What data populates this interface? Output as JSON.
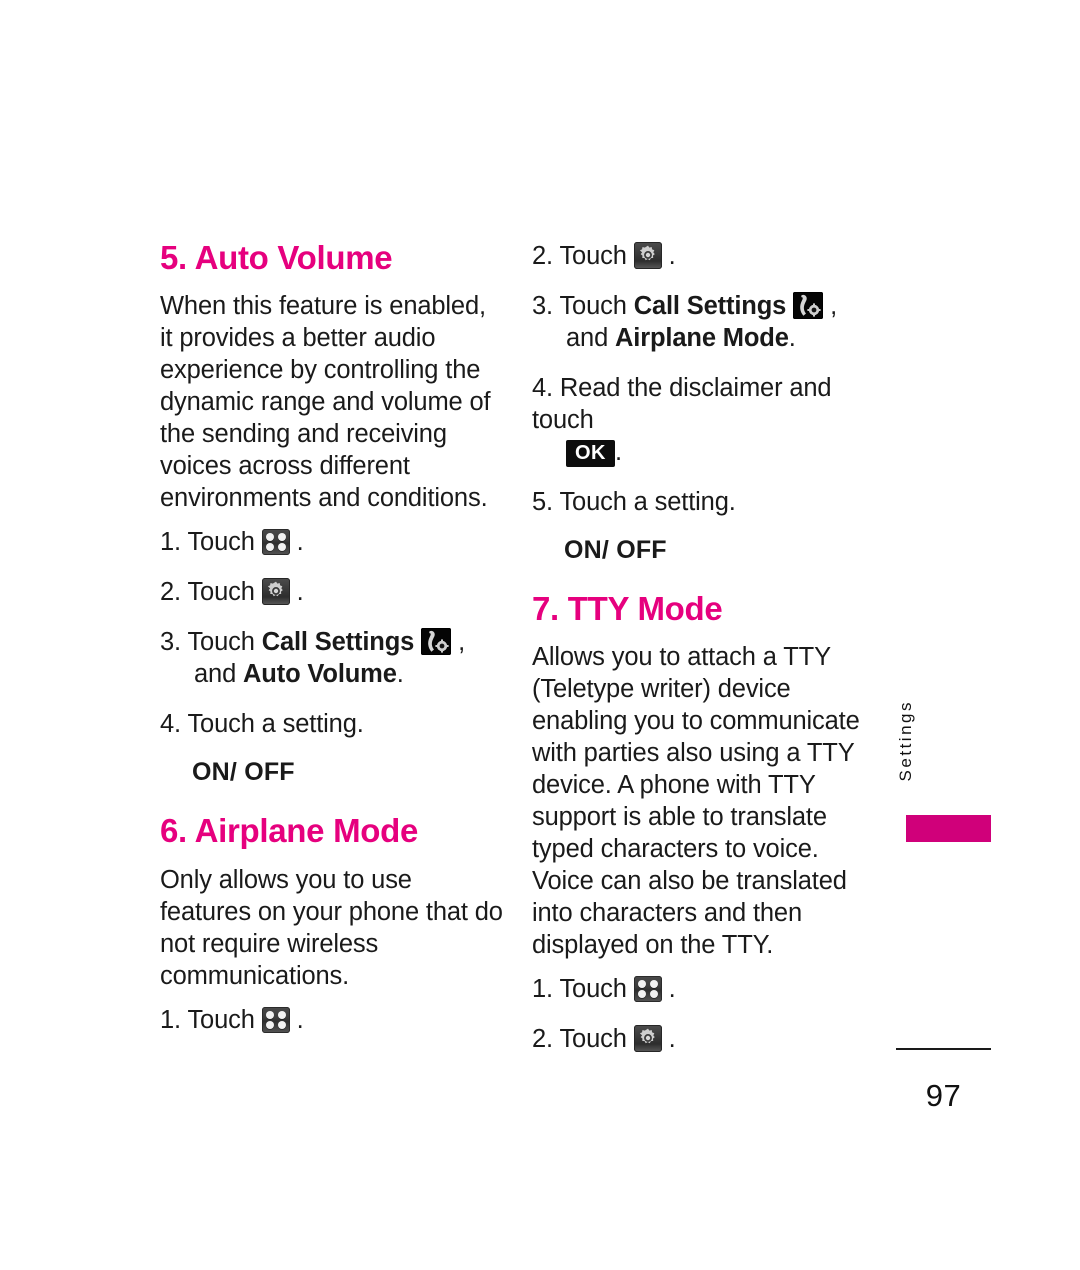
{
  "document": {
    "page_number": "97",
    "side_tab_label": "Settings",
    "accent_color": "#e6007e",
    "tab_bar_color": "#d0007a"
  },
  "icons": {
    "grid": "grid-menu-icon",
    "gear": "settings-gear-icon",
    "call_settings": "call-settings-phone-gear-icon",
    "ok_key": "OK"
  },
  "left_column": {
    "section_auto_volume": {
      "heading": "5. Auto Volume",
      "body": "When this feature is enabled, it provides a better audio experience by controlling the dynamic range and volume of the sending and receiving voices across different environments and conditions.",
      "steps": [
        {
          "num": "1.",
          "text": "Touch",
          "after": "."
        },
        {
          "num": "2.",
          "text": "Touch",
          "after": "."
        },
        {
          "num": "3.",
          "text": "Touch",
          "bold": "Call Settings",
          "after": ",",
          "cont_pre": "and ",
          "cont_bold": "Auto Volume",
          "cont_post": "."
        },
        {
          "num": "4.",
          "text": "Touch a setting."
        }
      ],
      "setting_values": "ON/ OFF"
    },
    "section_airplane_mode": {
      "heading": "6. Airplane Mode",
      "body": "Only allows you to use features on your phone that do not require wireless communications.",
      "steps": [
        {
          "num": "1.",
          "text": "Touch",
          "after": "."
        }
      ]
    }
  },
  "right_column": {
    "airplane_mode_continued": {
      "steps": [
        {
          "num": "2.",
          "text": "Touch",
          "after": "."
        },
        {
          "num": "3.",
          "text": "Touch",
          "bold": "Call Settings",
          "after": ",",
          "cont_pre": "and ",
          "cont_bold": "Airplane Mode",
          "cont_post": "."
        },
        {
          "num": "4.",
          "text": "Read the disclaimer and touch",
          "after": "."
        },
        {
          "num": "5.",
          "text": "Touch a setting."
        }
      ],
      "setting_values": "ON/ OFF"
    },
    "section_tty_mode": {
      "heading": "7. TTY Mode",
      "body": "Allows you to attach a TTY (Teletype writer) device enabling you to communicate with parties also using a TTY device. A phone with TTY support is able to translate typed characters to voice. Voice can also be translated into characters and then displayed on the TTY.",
      "steps": [
        {
          "num": "1.",
          "text": "Touch",
          "after": "."
        },
        {
          "num": "2.",
          "text": "Touch",
          "after": "."
        }
      ]
    }
  }
}
